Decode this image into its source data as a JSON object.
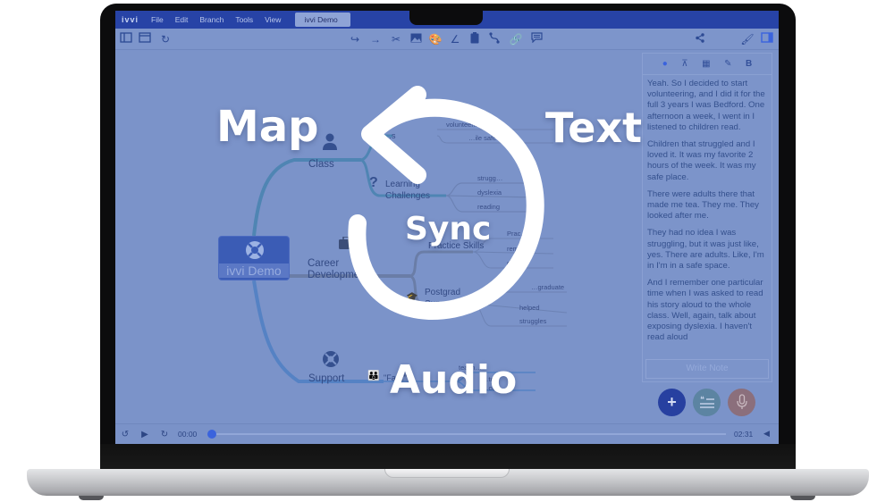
{
  "menubar": {
    "logo": "ivvi",
    "items": [
      "File",
      "Edit",
      "Branch",
      "Tools",
      "View"
    ],
    "document_tab": "ivvi Demo"
  },
  "toolbar": {
    "left_icons": [
      "sidebar-icon",
      "window-icon",
      "history-icon"
    ],
    "center_icons": [
      "add-sibling-icon",
      "add-child-icon",
      "cut-icon",
      "image-icon",
      "palette-icon",
      "line-icon",
      "clipboard-icon",
      "connector-icon",
      "link-icon",
      "comment-icon"
    ],
    "right_icons": [
      "share-icon",
      "brush-icon",
      "panel-toggle-icon"
    ]
  },
  "map": {
    "root": "ivvi Demo",
    "branches": [
      {
        "label": "Class",
        "icon": "user-icon"
      },
      {
        "label": "Career Development",
        "icon": "briefcase-icon"
      },
      {
        "label": "Support",
        "icon": "lifebuoy-icon"
      }
    ],
    "subnodes": [
      {
        "label": "…s",
        "icon": "heart-icon"
      },
      {
        "label": "Learning Challenges",
        "icon": "question-icon"
      },
      {
        "label": "Practice Skills",
        "icon": "book-icon"
      },
      {
        "label": "Postgrad Support",
        "icon": "graduation-cap-icon"
      },
      {
        "label": "\"Fa…\"",
        "icon": "family-icon"
      }
    ],
    "leaves": [
      {
        "label": "volunteering",
        "icon": "hands-icon"
      },
      {
        "label": "…ile safe",
        "icon": "shield-icon"
      },
      {
        "label": "strugg…",
        "icon": "face-icon"
      },
      {
        "label": "dyslexia",
        "icon": "question-icon"
      },
      {
        "label": "reading",
        "icon": "book-icon"
      },
      {
        "label": "Prac…",
        "icon": "book-icon"
      },
      {
        "label": "rem…",
        "icon": "moon-icon"
      },
      {
        "label": "d…",
        "icon": "screen-icon"
      },
      {
        "label": "…graduate",
        "icon": "cap-icon"
      },
      {
        "label": "helped",
        "icon": "hand-icon"
      },
      {
        "label": "struggles",
        "icon": "skull-icon"
      },
      {
        "label": "teach…",
        "icon": "teacher-icon"
      },
      {
        "label": "…te",
        "icon": "people-icon"
      },
      {
        "label": "…co…",
        "icon": "people-icon"
      }
    ]
  },
  "panel": {
    "tools": [
      "mic-icon",
      "sitemap-icon",
      "layout-icon",
      "pencil-icon",
      "bold-icon"
    ],
    "paragraphs": [
      "Yeah. So I decided to start volunteering, and I did it for the full 3 years I was Bedford. One afternoon a week, I went in I listened to children read.",
      "Children that struggled and I loved it. It was my favorite 2 hours of the week. It was my safe place.",
      "There were adults there that made me tea. They me. They looked after me.",
      "They had no idea I was struggling, but it was just like, yes. There are adults. Like, I'm in I'm in a safe space.",
      "And I remember one particular time when I was asked to read his story aloud to the whole class. Well, again, talk about exposing dyslexia. I haven't read aloud"
    ],
    "write_note_placeholder": "Write Note",
    "fab_add": "+",
    "fab_quote": "❝",
    "fab_mic": "🎙"
  },
  "player": {
    "current_time": "00:00",
    "end_time": "02:31",
    "progress": 0.0
  },
  "overlay": {
    "map": "Map",
    "text": "Text",
    "sync": "Sync",
    "audio": "Audio"
  },
  "colors": {
    "menubar": "#2743a6",
    "screen_tint": "#7b93c9",
    "accent": "#3a63dd",
    "add_fab": "#2740a0"
  }
}
